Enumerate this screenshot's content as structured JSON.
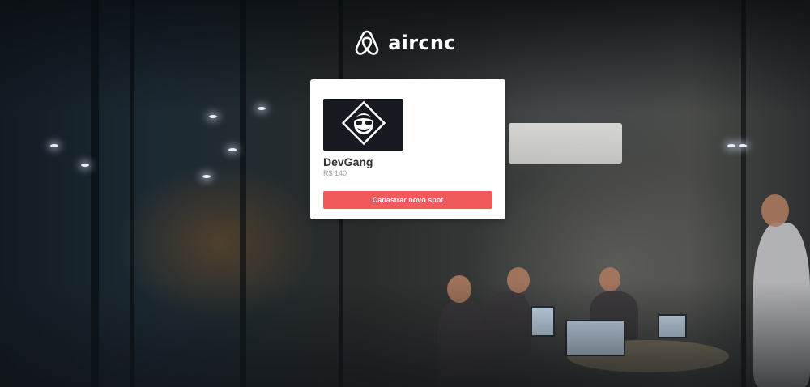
{
  "brand": {
    "name": "aircnc",
    "logo_icon": "airbnb-logo-icon"
  },
  "spot": {
    "thumbnail_icon": "devgang-logo-icon",
    "name": "DevGang",
    "price": "R$ 140"
  },
  "actions": {
    "register_label": "Cadastrar novo spot"
  },
  "colors": {
    "accent": "#f05a5b",
    "card_bg": "#ffffff"
  }
}
